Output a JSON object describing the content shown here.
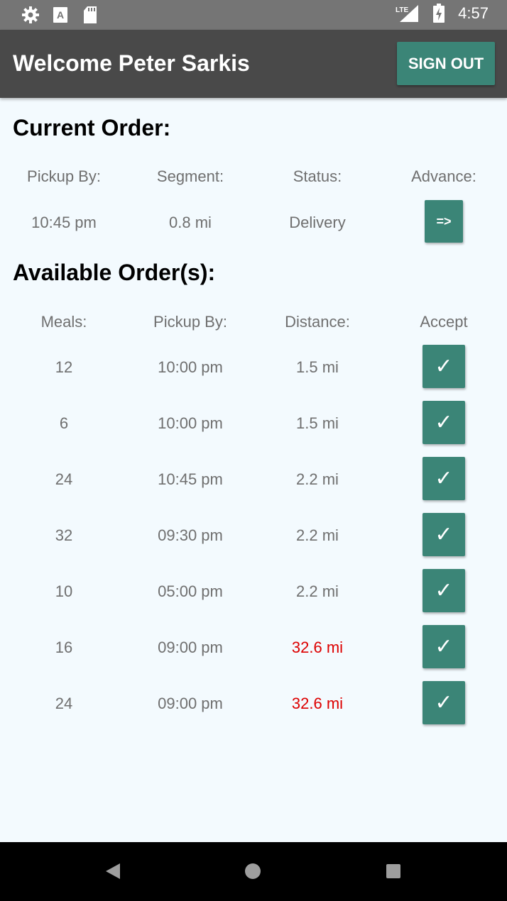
{
  "status_bar": {
    "time": "4:57",
    "left_icons": [
      "gear-icon",
      "font-icon",
      "sd-card-icon"
    ],
    "right_icons": [
      "lte-signal-icon",
      "battery-charging-icon"
    ],
    "network_label": "LTE"
  },
  "app_bar": {
    "title": "Welcome Peter Sarkis",
    "sign_out_label": "SIGN OUT",
    "background": "#494949",
    "accent": "#3b8577"
  },
  "current_order": {
    "title": "Current Order:",
    "headers": [
      "Pickup By:",
      "Segment:",
      "Status:",
      "Advance:"
    ],
    "pickup_by": "10:45 pm",
    "segment": "0.8 mi",
    "status": "Delivery",
    "advance_label": "=>"
  },
  "available_orders": {
    "title": "Available Order(s):",
    "headers": [
      "Meals:",
      "Pickup By:",
      "Distance:",
      "Accept"
    ],
    "accept_glyph": "✓",
    "far_color": "#dd0000",
    "rows": [
      {
        "meals": "12",
        "pickup_by": "10:00 pm",
        "distance": "1.5 mi",
        "far": false
      },
      {
        "meals": "6",
        "pickup_by": "10:00 pm",
        "distance": "1.5 mi",
        "far": false
      },
      {
        "meals": "24",
        "pickup_by": "10:45 pm",
        "distance": "2.2 mi",
        "far": false
      },
      {
        "meals": "32",
        "pickup_by": "09:30 pm",
        "distance": "2.2 mi",
        "far": false
      },
      {
        "meals": "10",
        "pickup_by": "05:00 pm",
        "distance": "2.2 mi",
        "far": false
      },
      {
        "meals": "16",
        "pickup_by": "09:00 pm",
        "distance": "32.6 mi",
        "far": true
      },
      {
        "meals": "24",
        "pickup_by": "09:00 pm",
        "distance": "32.6 mi",
        "far": true
      }
    ]
  },
  "nav_bar": {
    "buttons": [
      "back-icon",
      "home-icon",
      "recents-icon"
    ]
  }
}
